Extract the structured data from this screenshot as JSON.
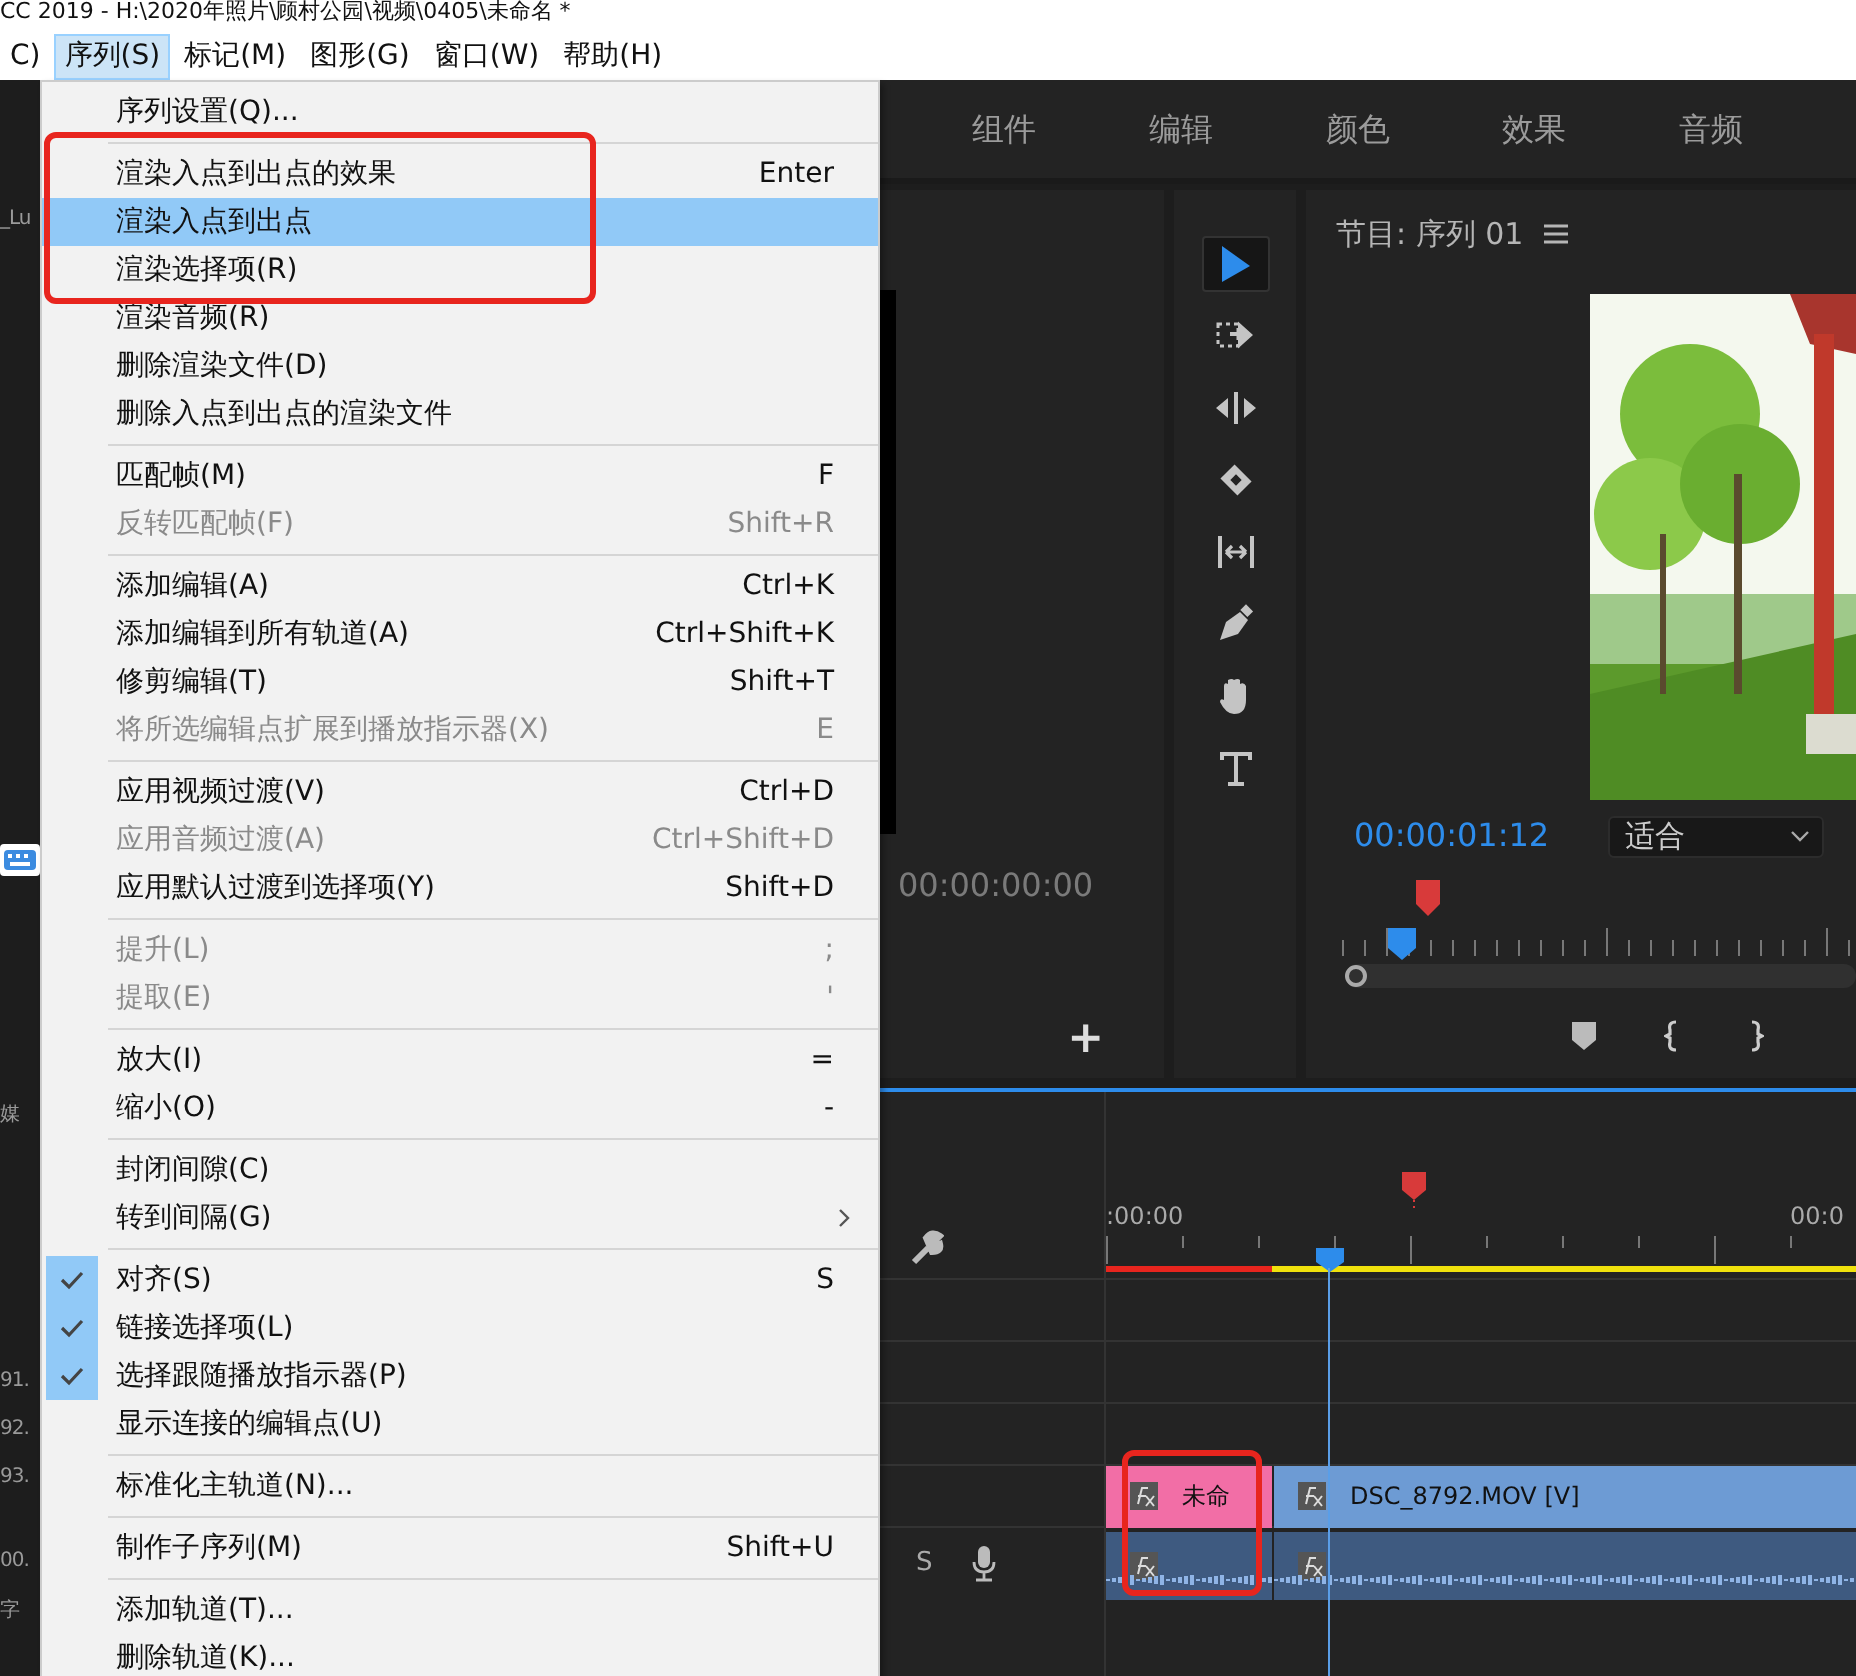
{
  "title_bar": {
    "title": "CC 2019 - H:\\2020年照片\\顾村公园\\视频\\0405\\未命名 *"
  },
  "menu_bar": [
    {
      "label": "C)",
      "selected": false
    },
    {
      "label": "序列(S)",
      "selected": true
    },
    {
      "label": "标记(M)",
      "selected": false
    },
    {
      "label": "图形(G)",
      "selected": false
    },
    {
      "label": "窗口(W)",
      "selected": false
    },
    {
      "label": "帮助(H)",
      "selected": false
    }
  ],
  "left_panel": {
    "texts": [
      "_Lu",
      "媒",
      "91.",
      "92.",
      "93.",
      "00.",
      "字"
    ]
  },
  "workspace_tabs": [
    "组件",
    "编辑",
    "颜色",
    "效果",
    "音频"
  ],
  "source_monitor": {
    "timecode": "00:00:00:00",
    "add_button": "+"
  },
  "tools": [
    {
      "kind": "selection",
      "selected": true
    },
    {
      "kind": "track-select",
      "selected": false
    },
    {
      "kind": "ripple",
      "selected": false
    },
    {
      "kind": "razor",
      "selected": false
    },
    {
      "kind": "slip",
      "selected": false
    },
    {
      "kind": "pen",
      "selected": false
    },
    {
      "kind": "hand",
      "selected": false
    },
    {
      "kind": "type",
      "selected": false
    }
  ],
  "program_monitor": {
    "title": "节目: 序列 01",
    "timecode": "00:00:01:12",
    "zoom": "适合"
  },
  "timeline": {
    "timecodes": [
      ":00:00",
      "00:0"
    ],
    "track_label": "S",
    "clips": [
      {
        "kind": "video",
        "label": "未命",
        "color": "#f26ea6"
      },
      {
        "kind": "video",
        "label": "DSC_8792.MOV [V]",
        "color": "#6d9bd4"
      },
      {
        "kind": "audio",
        "color": "#3e5a80"
      },
      {
        "kind": "audio",
        "color": "#3e5a80"
      }
    ]
  },
  "sequence_menu": {
    "items": [
      {
        "kind": "item",
        "label": "序列设置(Q)...",
        "disabled": false,
        "checked": false,
        "highlighted": false,
        "submenu": false
      },
      {
        "kind": "separator"
      },
      {
        "kind": "item",
        "label": "渲染入点到出点的效果",
        "shortcut": "Enter",
        "disabled": false,
        "checked": false,
        "highlighted": false,
        "submenu": false
      },
      {
        "kind": "item",
        "label": "渲染入点到出点",
        "disabled": false,
        "checked": false,
        "highlighted": true,
        "submenu": false
      },
      {
        "kind": "item",
        "label": "渲染选择项(R)",
        "disabled": false,
        "checked": false,
        "highlighted": false,
        "submenu": false
      },
      {
        "kind": "item",
        "label": "渲染音频(R)",
        "disabled": false,
        "checked": false,
        "highlighted": false,
        "submenu": false
      },
      {
        "kind": "item",
        "label": "删除渲染文件(D)",
        "disabled": false,
        "checked": false,
        "highlighted": false,
        "submenu": false
      },
      {
        "kind": "item",
        "label": "删除入点到出点的渲染文件",
        "disabled": false,
        "checked": false,
        "highlighted": false,
        "submenu": false
      },
      {
        "kind": "separator"
      },
      {
        "kind": "item",
        "label": "匹配帧(M)",
        "shortcut": "F",
        "disabled": false,
        "checked": false,
        "highlighted": false,
        "submenu": false
      },
      {
        "kind": "item",
        "label": "反转匹配帧(F)",
        "shortcut": "Shift+R",
        "disabled": true,
        "checked": false,
        "highlighted": false,
        "submenu": false
      },
      {
        "kind": "separator"
      },
      {
        "kind": "item",
        "label": "添加编辑(A)",
        "shortcut": "Ctrl+K",
        "disabled": false,
        "checked": false,
        "highlighted": false,
        "submenu": false
      },
      {
        "kind": "item",
        "label": "添加编辑到所有轨道(A)",
        "shortcut": "Ctrl+Shift+K",
        "disabled": false,
        "checked": false,
        "highlighted": false,
        "submenu": false
      },
      {
        "kind": "item",
        "label": "修剪编辑(T)",
        "shortcut": "Shift+T",
        "disabled": false,
        "checked": false,
        "highlighted": false,
        "submenu": false
      },
      {
        "kind": "item",
        "label": "将所选编辑点扩展到播放指示器(X)",
        "shortcut": "E",
        "disabled": true,
        "checked": false,
        "highlighted": false,
        "submenu": false
      },
      {
        "kind": "separator"
      },
      {
        "kind": "item",
        "label": "应用视频过渡(V)",
        "shortcut": "Ctrl+D",
        "disabled": false,
        "checked": false,
        "highlighted": false,
        "submenu": false
      },
      {
        "kind": "item",
        "label": "应用音频过渡(A)",
        "shortcut": "Ctrl+Shift+D",
        "disabled": true,
        "checked": false,
        "highlighted": false,
        "submenu": false
      },
      {
        "kind": "item",
        "label": "应用默认过渡到选择项(Y)",
        "shortcut": "Shift+D",
        "disabled": false,
        "checked": false,
        "highlighted": false,
        "submenu": false
      },
      {
        "kind": "separator"
      },
      {
        "kind": "item",
        "label": "提升(L)",
        "shortcut": ";",
        "disabled": true,
        "checked": false,
        "highlighted": false,
        "submenu": false
      },
      {
        "kind": "item",
        "label": "提取(E)",
        "shortcut": "'",
        "disabled": true,
        "checked": false,
        "highlighted": false,
        "submenu": false
      },
      {
        "kind": "separator"
      },
      {
        "kind": "item",
        "label": "放大(I)",
        "shortcut": "=",
        "disabled": false,
        "checked": false,
        "highlighted": false,
        "submenu": false
      },
      {
        "kind": "item",
        "label": "缩小(O)",
        "shortcut": "-",
        "disabled": false,
        "checked": false,
        "highlighted": false,
        "submenu": false
      },
      {
        "kind": "separator"
      },
      {
        "kind": "item",
        "label": "封闭间隙(C)",
        "disabled": false,
        "checked": false,
        "highlighted": false,
        "submenu": false
      },
      {
        "kind": "item",
        "label": "转到间隔(G)",
        "disabled": false,
        "checked": false,
        "highlighted": false,
        "submenu": true
      },
      {
        "kind": "separator"
      },
      {
        "kind": "item",
        "label": "对齐(S)",
        "shortcut": "S",
        "disabled": false,
        "checked": true,
        "highlighted": false,
        "submenu": false
      },
      {
        "kind": "item",
        "label": "链接选择项(L)",
        "disabled": false,
        "checked": true,
        "highlighted": false,
        "submenu": false
      },
      {
        "kind": "item",
        "label": "选择跟随播放指示器(P)",
        "disabled": false,
        "checked": true,
        "highlighted": false,
        "submenu": false
      },
      {
        "kind": "item",
        "label": "显示连接的编辑点(U)",
        "disabled": false,
        "checked": false,
        "highlighted": false,
        "submenu": false
      },
      {
        "kind": "separator"
      },
      {
        "kind": "item",
        "label": "标准化主轨道(N)...",
        "disabled": false,
        "checked": false,
        "highlighted": false,
        "submenu": false
      },
      {
        "kind": "separator"
      },
      {
        "kind": "item",
        "label": "制作子序列(M)",
        "shortcut": "Shift+U",
        "disabled": false,
        "checked": false,
        "highlighted": false,
        "submenu": false
      },
      {
        "kind": "separator"
      },
      {
        "kind": "item",
        "label": "添加轨道(T)...",
        "disabled": false,
        "checked": false,
        "highlighted": false,
        "submenu": false
      },
      {
        "kind": "item",
        "label": "删除轨道(K)...",
        "disabled": false,
        "checked": false,
        "highlighted": false,
        "submenu": false
      }
    ]
  }
}
